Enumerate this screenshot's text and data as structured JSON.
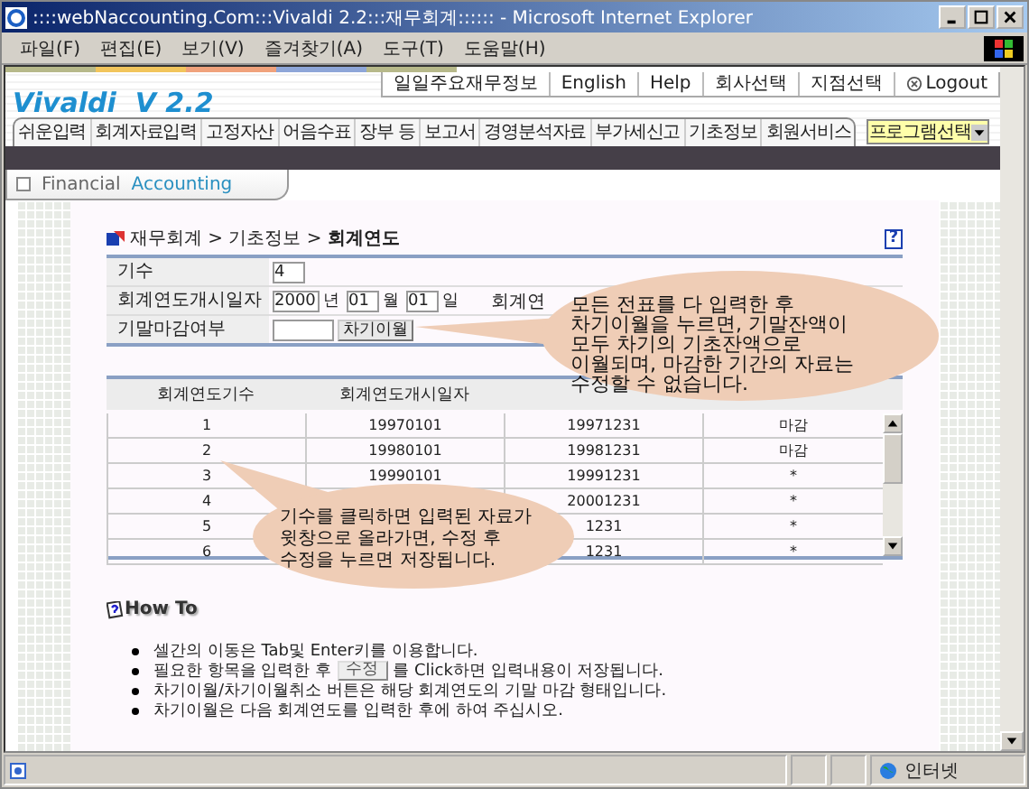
{
  "window": {
    "title": "::::webNaccounting.Com:::Vivaldi 2.2:::재무회계:::::: - Microsoft Internet Explorer"
  },
  "menu": [
    "파일(F)",
    "편집(E)",
    "보기(V)",
    "즐겨찾기(A)",
    "도구(T)",
    "도움말(H)"
  ],
  "logo": "Vivaldi  V 2.2",
  "top_links": [
    {
      "label": "일일주요재무정보",
      "kind": "text"
    },
    {
      "label": "English",
      "kind": "text"
    },
    {
      "label": "Help",
      "kind": "text"
    },
    {
      "label": "회사선택",
      "kind": "text"
    },
    {
      "label": "지점선택",
      "kind": "text"
    },
    {
      "label": "Logout",
      "kind": "logout"
    }
  ],
  "nav_tabs": [
    "쉬운입력",
    "회계자료입력",
    "고정자산",
    "어음수표",
    "장부 등",
    "보고서",
    "경영분석자료",
    "부가세신고",
    "기초정보",
    "회원서비스"
  ],
  "program_select": {
    "value": "프로그램선택"
  },
  "section_tab": {
    "label_1": "Financial",
    "label_2": "Accounting"
  },
  "help_button": "?",
  "breadcrumb": "재무회계 > 기초정보 > **회계연도**",
  "form": {
    "rows": [
      {
        "kind": "number",
        "label": "기수",
        "value": "4"
      },
      {
        "kind": "date",
        "label": "회계연도개시일자",
        "year": "2000",
        "year_unit": "년",
        "month": "01",
        "month_unit": "월",
        "day": "01",
        "day_unit": "일",
        "side_label": "회계연"
      },
      {
        "kind": "close",
        "label": "기말마감여부",
        "button": "차기이월"
      }
    ]
  },
  "table": {
    "columns": [
      "회계연도기수",
      "회계연도개시일자"
    ],
    "rows": [
      {
        "period": "1",
        "start": "19970101",
        "end": "19971231",
        "status": "마감"
      },
      {
        "period": "2",
        "start": "19980101",
        "end": "19981231",
        "status": "마감"
      },
      {
        "period": "3",
        "start": "19990101",
        "end": "19991231",
        "status": "*"
      },
      {
        "period": "4",
        "end": "20001231",
        "status": "*"
      },
      {
        "period": "5",
        "end": "1231",
        "status": "*"
      },
      {
        "period": "6",
        "end": "1231",
        "status": "*"
      }
    ]
  },
  "callouts": [
    {
      "lines": [
        "모든 전표를 다 입력한 후",
        "차기이월을 누르면, 기말잔액이",
        "모두 차기의 기초잔액으로",
        "이월되며, 마감한 기간의 자료는",
        "수정할 수 없습니다."
      ]
    },
    {
      "lines": [
        "기수를 클릭하면 입력된 자료가",
        "윗창으로 올라가면, 수정 후",
        "수정을 누르면 저장됩니다."
      ]
    }
  ],
  "howto": {
    "title": "How To",
    "items": [
      {
        "kind": "text",
        "text": "셀간의 이동은 Tab및 Enter키를 이용합니다."
      },
      {
        "kind": "button",
        "before": "필요한 항목을 입력한 후",
        "button": "수정",
        "after": "를 Click하면 입력내용이 저장됩니다."
      },
      {
        "kind": "text",
        "text": "차기이월/차기이월취소 버튼은 해당 회계연도의 기말 마감 형태입니다."
      },
      {
        "kind": "text",
        "text": "차기이월은 다음 회계연도를 입력한 후에 하여 주십시오."
      }
    ]
  },
  "status_bar": {
    "zone": "인터넷"
  }
}
